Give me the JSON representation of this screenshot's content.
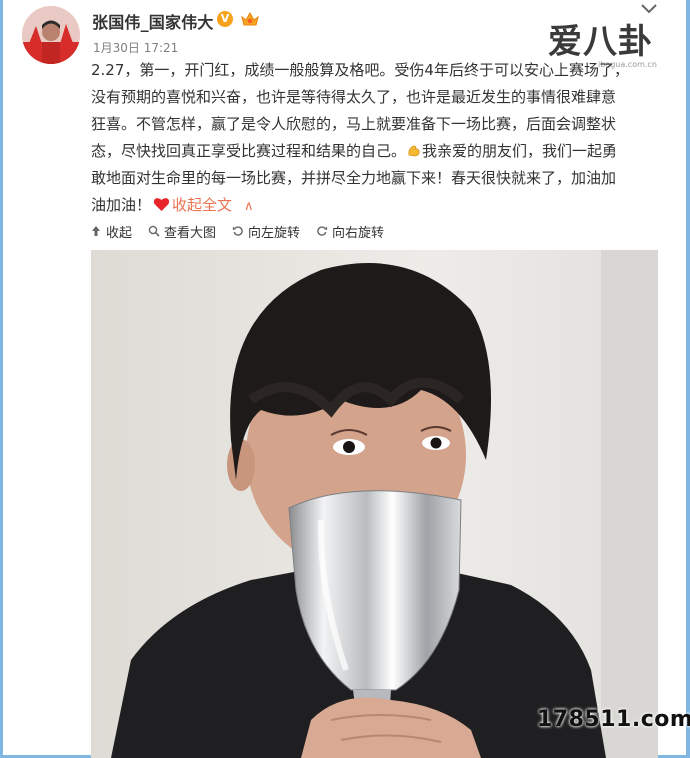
{
  "post": {
    "username": "张国伟_国家伟大",
    "verified_badge": "V",
    "time": "1月30日 17:21",
    "text_lines": [
      "2.27，第一，开门红，成绩一般般算及格吧。受伤4年后终于可以安心上赛场了，",
      "没有预期的喜悦和兴奋，也许是等待得太久了，也许是最近发生的事情很难肆意",
      "狂喜。不管怎样，赢了是令人欣慰的，马上就要准备下一场比赛，后面会调整状",
      "态，尽快找回真正享受比赛过程和结果的自己。",
      "我亲爱的朋友们，我们一起勇",
      "敢地面对生命里的每一场比赛，并拼尽全力地赢下来！春天很快就来了，加油加",
      "油加油！"
    ],
    "collapse_label": "收起全文",
    "collapse_chevron": "∧"
  },
  "toolbar": {
    "collapse": "收起",
    "view_large": "查看大图",
    "rotate_left": "向左旋转",
    "rotate_right": "向右旋转"
  },
  "watermarks": {
    "top_logo": "爱八卦",
    "top_url": "ibagua.com.cn",
    "bottom": "178511.com"
  },
  "icons": {
    "chevron": "chevron-down-icon",
    "verified": "verified-v-icon",
    "vip": "vip-crown-icon",
    "muscle": "flexed-biceps-emoji",
    "heart": "red-heart-emoji"
  },
  "colors": {
    "link": "#eb7350",
    "frame": "#7fb6e2",
    "verified": "#f7a21b"
  }
}
